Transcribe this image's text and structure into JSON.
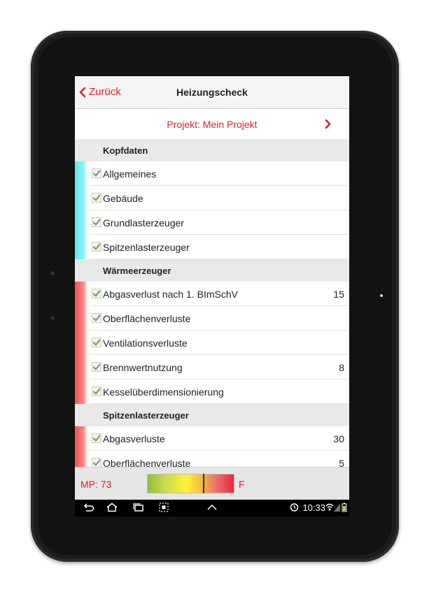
{
  "header": {
    "back_label": "Zurück",
    "title": "Heizungscheck"
  },
  "project": {
    "label": "Projekt: Mein Projekt"
  },
  "sections": [
    {
      "title": "Kopfdaten",
      "color": "cyan",
      "items": [
        {
          "label": "Allgemeines",
          "value": ""
        },
        {
          "label": "Gebäude",
          "value": ""
        },
        {
          "label": "Grundlasterzeuger",
          "value": ""
        },
        {
          "label": "Spitzenlasterzeuger",
          "value": ""
        }
      ]
    },
    {
      "title": "Wärmeerzeuger",
      "color": "red",
      "items": [
        {
          "label": "Abgasverlust nach 1. BImSchV",
          "value": "15"
        },
        {
          "label": "Oberflächenverluste",
          "value": ""
        },
        {
          "label": "Ventilationsverluste",
          "value": ""
        },
        {
          "label": "Brennwertnutzung",
          "value": "8"
        },
        {
          "label": "Kesselüberdimensionierung",
          "value": ""
        }
      ]
    },
    {
      "title": "Spitzenlasterzeuger",
      "color": "red",
      "items": [
        {
          "label": "Abgasverluste",
          "value": "30"
        },
        {
          "label": "Oberflächenverluste",
          "value": "5"
        }
      ]
    }
  ],
  "footer": {
    "mp_label": "MP: 73",
    "scale_end": "F",
    "scale_position": 0.64
  },
  "status_bar": {
    "time": "10:33"
  },
  "colors": {
    "accent": "#d7202f",
    "check": "#6aa84f"
  }
}
